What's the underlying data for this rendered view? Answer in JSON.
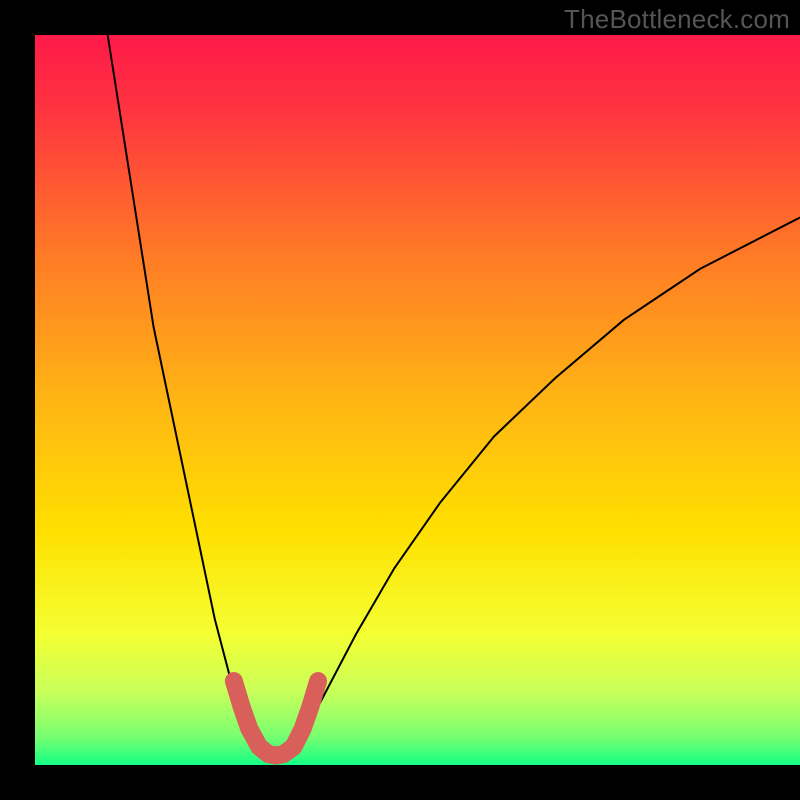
{
  "attribution": "TheBottleneck.com",
  "chart_data": {
    "type": "line",
    "title": "",
    "xlabel": "",
    "ylabel": "",
    "xlim": [
      0,
      100
    ],
    "ylim": [
      0,
      100
    ],
    "background_gradient_stops": [
      {
        "pos": 0.0,
        "color": "#ff1a4a"
      },
      {
        "pos": 0.1,
        "color": "#ff3340"
      },
      {
        "pos": 0.3,
        "color": "#ff7a26"
      },
      {
        "pos": 0.5,
        "color": "#ffb514"
      },
      {
        "pos": 0.68,
        "color": "#ffe000"
      },
      {
        "pos": 0.82,
        "color": "#f4ff32"
      },
      {
        "pos": 0.9,
        "color": "#c8ff5a"
      },
      {
        "pos": 0.96,
        "color": "#7aff70"
      },
      {
        "pos": 1.0,
        "color": "#14ff84"
      }
    ],
    "series": [
      {
        "name": "curve-left",
        "color": "#000000",
        "stroke_width": 2,
        "values": [
          {
            "x": 9.5,
            "y": 100.0
          },
          {
            "x": 11.0,
            "y": 90.0
          },
          {
            "x": 12.5,
            "y": 80.0
          },
          {
            "x": 14.0,
            "y": 70.0
          },
          {
            "x": 15.5,
            "y": 60.0
          },
          {
            "x": 17.5,
            "y": 50.0
          },
          {
            "x": 19.5,
            "y": 40.0
          },
          {
            "x": 21.5,
            "y": 30.0
          },
          {
            "x": 23.5,
            "y": 20.0
          },
          {
            "x": 26.0,
            "y": 10.0
          },
          {
            "x": 28.0,
            "y": 4.0
          },
          {
            "x": 30.0,
            "y": 1.0
          },
          {
            "x": 31.0,
            "y": 0.5
          }
        ]
      },
      {
        "name": "curve-right",
        "color": "#000000",
        "stroke_width": 2,
        "values": [
          {
            "x": 32.0,
            "y": 0.5
          },
          {
            "x": 33.0,
            "y": 1.0
          },
          {
            "x": 35.0,
            "y": 4.0
          },
          {
            "x": 38.0,
            "y": 10.0
          },
          {
            "x": 42.0,
            "y": 18.0
          },
          {
            "x": 47.0,
            "y": 27.0
          },
          {
            "x": 53.0,
            "y": 36.0
          },
          {
            "x": 60.0,
            "y": 45.0
          },
          {
            "x": 68.0,
            "y": 53.0
          },
          {
            "x": 77.0,
            "y": 61.0
          },
          {
            "x": 87.0,
            "y": 68.0
          },
          {
            "x": 100.0,
            "y": 75.0
          }
        ]
      },
      {
        "name": "u-highlight",
        "color": "#d9605a",
        "stroke_width": 18,
        "stroke_linecap": "round",
        "values": [
          {
            "x": 26.0,
            "y": 11.5
          },
          {
            "x": 27.0,
            "y": 8.0
          },
          {
            "x": 28.0,
            "y": 5.0
          },
          {
            "x": 29.3,
            "y": 2.5
          },
          {
            "x": 30.5,
            "y": 1.5
          },
          {
            "x": 31.5,
            "y": 1.3
          },
          {
            "x": 32.5,
            "y": 1.5
          },
          {
            "x": 33.8,
            "y": 2.5
          },
          {
            "x": 35.0,
            "y": 5.0
          },
          {
            "x": 36.0,
            "y": 8.0
          },
          {
            "x": 37.0,
            "y": 11.5
          }
        ]
      }
    ]
  }
}
